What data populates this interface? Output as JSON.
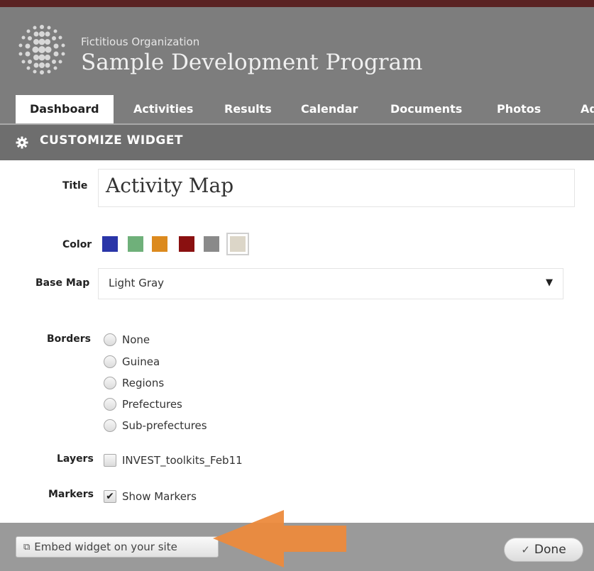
{
  "header": {
    "organization": "Fictitious Organization",
    "program": "Sample Development Program"
  },
  "tabs": [
    {
      "label": "Dashboard",
      "active": true
    },
    {
      "label": "Activities",
      "active": false
    },
    {
      "label": "Results",
      "active": false
    },
    {
      "label": "Calendar",
      "active": false
    },
    {
      "label": "Documents",
      "active": false
    },
    {
      "label": "Photos",
      "active": false
    },
    {
      "label": "Adr",
      "active": false
    }
  ],
  "section": {
    "icon": "gear-icon",
    "title": "CUSTOMIZE WIDGET"
  },
  "form": {
    "title_label": "Title",
    "title_value": "Activity Map",
    "color_label": "Color",
    "colors": [
      "#2a35a8",
      "#6fb07a",
      "#dc8a1e",
      "#8a1010",
      "#8a8a8a",
      "#dcd6c8"
    ],
    "selected_color_index": 5,
    "basemap_label": "Base Map",
    "basemap_value": "Light Gray",
    "borders_label": "Borders",
    "borders_options": [
      "None",
      "Guinea",
      "Regions",
      "Prefectures",
      "Sub-prefectures"
    ],
    "layers_label": "Layers",
    "layers_option": "INVEST_toolkits_Feb11",
    "layers_checked": false,
    "markers_label": "Markers",
    "markers_option": "Show Markers",
    "markers_checked": true
  },
  "footer": {
    "embed_label": "Embed widget on your site",
    "done_label": "Done",
    "done_icon": "checkmark-icon",
    "arrow_color": "#ec8a3c"
  },
  "colors": {
    "topbar": "#5a2222",
    "header": "#7d7d7d",
    "section": "#6e6e6e",
    "footer": "#9a9a9a"
  }
}
